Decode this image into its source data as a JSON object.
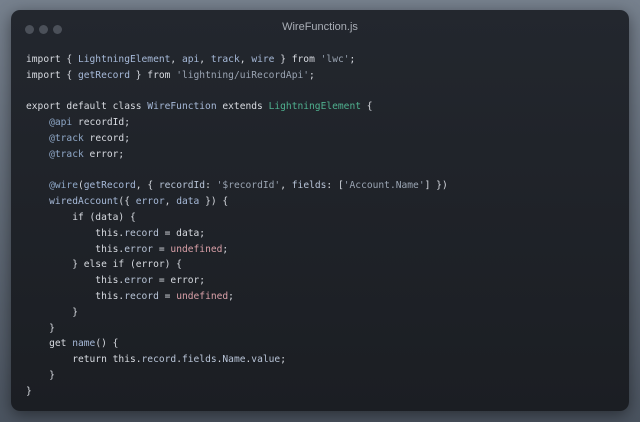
{
  "window": {
    "title": "WireFunction.js"
  },
  "colors": {
    "background": "#5d6672",
    "editor": "#1f2328",
    "text": "#d7dae0",
    "class_name": "#4fb08f",
    "string": "#9aa4b2",
    "decorator": "#8fa8c8",
    "undefined_literal": "#d9a0a8"
  },
  "code_lines": [
    [
      {
        "t": "import { ",
        "c": "tx"
      },
      {
        "t": "LightningElement",
        "c": "fn"
      },
      {
        "t": ", ",
        "c": "tx"
      },
      {
        "t": "api",
        "c": "fn"
      },
      {
        "t": ", ",
        "c": "tx"
      },
      {
        "t": "track",
        "c": "fn"
      },
      {
        "t": ", ",
        "c": "tx"
      },
      {
        "t": "wire",
        "c": "fn"
      },
      {
        "t": " } from ",
        "c": "tx"
      },
      {
        "t": "'lwc'",
        "c": "str"
      },
      {
        "t": ";",
        "c": "tx"
      }
    ],
    [
      {
        "t": "import { ",
        "c": "tx"
      },
      {
        "t": "getRecord",
        "c": "fn"
      },
      {
        "t": " } from ",
        "c": "tx"
      },
      {
        "t": "'lightning/uiRecordApi'",
        "c": "str"
      },
      {
        "t": ";",
        "c": "tx"
      }
    ],
    [],
    [
      {
        "t": "export default class ",
        "c": "tx"
      },
      {
        "t": "WireFunction",
        "c": "fn"
      },
      {
        "t": " extends ",
        "c": "tx"
      },
      {
        "t": "LightningElement",
        "c": "cls"
      },
      {
        "t": " {",
        "c": "tx"
      }
    ],
    [
      {
        "t": "    ",
        "c": "tx"
      },
      {
        "t": "@api",
        "c": "dec"
      },
      {
        "t": " recordId;",
        "c": "tx"
      }
    ],
    [
      {
        "t": "    ",
        "c": "tx"
      },
      {
        "t": "@track",
        "c": "dec"
      },
      {
        "t": " record;",
        "c": "tx"
      }
    ],
    [
      {
        "t": "    ",
        "c": "tx"
      },
      {
        "t": "@track",
        "c": "dec"
      },
      {
        "t": " error;",
        "c": "tx"
      }
    ],
    [],
    [
      {
        "t": "    ",
        "c": "tx"
      },
      {
        "t": "@wire",
        "c": "dec"
      },
      {
        "t": "(",
        "c": "tx"
      },
      {
        "t": "getRecord",
        "c": "fn"
      },
      {
        "t": ", { ",
        "c": "tx"
      },
      {
        "t": "recordId",
        "c": "prop"
      },
      {
        "t": ": ",
        "c": "tx"
      },
      {
        "t": "'$recordId'",
        "c": "str"
      },
      {
        "t": ", ",
        "c": "tx"
      },
      {
        "t": "fields",
        "c": "prop"
      },
      {
        "t": ": [",
        "c": "tx"
      },
      {
        "t": "'Account.Name'",
        "c": "str"
      },
      {
        "t": "] })",
        "c": "tx"
      }
    ],
    [
      {
        "t": "    ",
        "c": "tx"
      },
      {
        "t": "wiredAccount",
        "c": "fn"
      },
      {
        "t": "({ ",
        "c": "tx"
      },
      {
        "t": "error",
        "c": "fn"
      },
      {
        "t": ", ",
        "c": "tx"
      },
      {
        "t": "data",
        "c": "fn"
      },
      {
        "t": " }) {",
        "c": "tx"
      }
    ],
    [
      {
        "t": "        if (data) {",
        "c": "tx"
      }
    ],
    [
      {
        "t": "            this.",
        "c": "tx"
      },
      {
        "t": "record",
        "c": "prop"
      },
      {
        "t": " = data;",
        "c": "tx"
      }
    ],
    [
      {
        "t": "            this.",
        "c": "tx"
      },
      {
        "t": "error",
        "c": "prop"
      },
      {
        "t": " = ",
        "c": "tx"
      },
      {
        "t": "undefined",
        "c": "undef"
      },
      {
        "t": ";",
        "c": "tx"
      }
    ],
    [
      {
        "t": "        } else if (error) {",
        "c": "tx"
      }
    ],
    [
      {
        "t": "            this.",
        "c": "tx"
      },
      {
        "t": "error",
        "c": "prop"
      },
      {
        "t": " = error;",
        "c": "tx"
      }
    ],
    [
      {
        "t": "            this.",
        "c": "tx"
      },
      {
        "t": "record",
        "c": "prop"
      },
      {
        "t": " = ",
        "c": "tx"
      },
      {
        "t": "undefined",
        "c": "undef"
      },
      {
        "t": ";",
        "c": "tx"
      }
    ],
    [
      {
        "t": "        }",
        "c": "tx"
      }
    ],
    [
      {
        "t": "    }",
        "c": "tx"
      }
    ],
    [
      {
        "t": "    get ",
        "c": "tx"
      },
      {
        "t": "name",
        "c": "fn"
      },
      {
        "t": "() {",
        "c": "tx"
      }
    ],
    [
      {
        "t": "        return this.",
        "c": "tx"
      },
      {
        "t": "record",
        "c": "prop"
      },
      {
        "t": ".",
        "c": "tx"
      },
      {
        "t": "fields",
        "c": "prop"
      },
      {
        "t": ".",
        "c": "tx"
      },
      {
        "t": "Name",
        "c": "prop"
      },
      {
        "t": ".",
        "c": "tx"
      },
      {
        "t": "value",
        "c": "prop"
      },
      {
        "t": ";",
        "c": "tx"
      }
    ],
    [
      {
        "t": "    }",
        "c": "tx"
      }
    ],
    [
      {
        "t": "}",
        "c": "tx"
      }
    ]
  ]
}
